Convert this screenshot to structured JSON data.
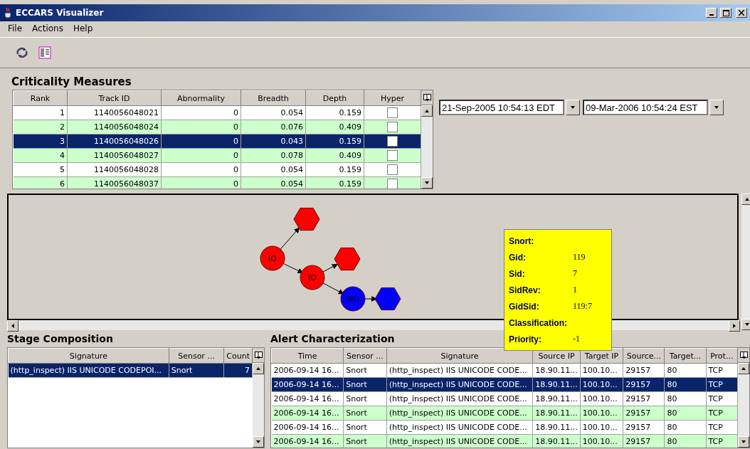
{
  "window": {
    "title": "ECCARS Visualizer"
  },
  "menu": [
    "File",
    "Actions",
    "Help"
  ],
  "criticality": {
    "title": "Criticality Measures",
    "columns": [
      "Rank",
      "Track ID",
      "Abnormality",
      "Breadth",
      "Depth",
      "Hyper"
    ],
    "rows": [
      {
        "cells": [
          "1",
          "1140056048021",
          "0",
          "0.054",
          "0.159"
        ],
        "hyper": false,
        "selected": false
      },
      {
        "cells": [
          "2",
          "1140056048024",
          "0",
          "0.076",
          "0.409"
        ],
        "hyper": false,
        "selected": false
      },
      {
        "cells": [
          "3",
          "1140056048026",
          "0",
          "0.043",
          "0.159"
        ],
        "hyper": false,
        "selected": true
      },
      {
        "cells": [
          "4",
          "1140056048027",
          "0",
          "0.078",
          "0.409"
        ],
        "hyper": false,
        "selected": false
      },
      {
        "cells": [
          "5",
          "1140056048028",
          "0",
          "0.054",
          "0.159"
        ],
        "hyper": false,
        "selected": false
      },
      {
        "cells": [
          "6",
          "1140056048037",
          "0",
          "0.054",
          "0.159"
        ],
        "hyper": false,
        "selected": false
      }
    ]
  },
  "date_range": {
    "start": "21-Sep-2005 10:54:13 EDT",
    "end": "09-Mar-2006 10:54:24 EST"
  },
  "graph": {
    "nodes": [
      {
        "kind": "circle",
        "label": "IO",
        "color": "#ff0000"
      },
      {
        "kind": "hexagon",
        "color": "#ff0000"
      },
      {
        "kind": "circle",
        "label": "IO",
        "color": "#ff0000"
      },
      {
        "kind": "hexagon",
        "color": "#ff0000"
      },
      {
        "kind": "circle",
        "label": "MO",
        "color": "#0000ff"
      },
      {
        "kind": "hexagon",
        "color": "#0000ff"
      }
    ]
  },
  "tooltip": {
    "rows": [
      {
        "label": "Snort:"
      },
      {
        "label": "Gid:",
        "value": "119"
      },
      {
        "label": "Sid:",
        "value": "7"
      },
      {
        "label": "SidRev:",
        "value": "1"
      },
      {
        "label": "GidSid:",
        "value": "119:7"
      },
      {
        "label": "Classification:"
      },
      {
        "label": "Priority:",
        "value": "-1"
      }
    ]
  },
  "stage": {
    "title": "Stage Composition",
    "columns": [
      "Signature",
      "Sensor ...",
      "Count"
    ],
    "rows": [
      {
        "cells": [
          "(http_inspect) IIS UNICODE CODEPOI...",
          "Snort",
          "7"
        ],
        "selected": true
      }
    ]
  },
  "alerts": {
    "title": "Alert Characterization",
    "columns": [
      "Time",
      "Sensor ...",
      "Signature",
      "Source IP",
      "Target IP",
      "Source...",
      "Target...",
      "Prot..."
    ],
    "rows": [
      {
        "cells": [
          "2006-09-14 16...",
          "Snort",
          "(http_inspect) IIS UNICODE CODE...",
          "18.90.11...",
          "100.10...",
          "29157",
          "80",
          "TCP"
        ],
        "selected": false
      },
      {
        "cells": [
          "2006-09-14 16...",
          "Snort",
          "(http_inspect) IIS UNICODE CODE...",
          "18.90.11...",
          "100.10...",
          "29157",
          "80",
          "TCP"
        ],
        "selected": true
      },
      {
        "cells": [
          "2006-09-14 16...",
          "Snort",
          "(http_inspect) IIS UNICODE CODE...",
          "18.90.11...",
          "100.10...",
          "29157",
          "80",
          "TCP"
        ],
        "selected": false
      },
      {
        "cells": [
          "2006-09-14 16...",
          "Snort",
          "(http_inspect) IIS UNICODE CODE...",
          "18.90.11...",
          "100.10...",
          "29157",
          "80",
          "TCP"
        ],
        "selected": false
      },
      {
        "cells": [
          "2006-09-14 16...",
          "Snort",
          "(http_inspect) IIS UNICODE CODE...",
          "18.90.11...",
          "100.10...",
          "29157",
          "80",
          "TCP"
        ],
        "selected": false
      },
      {
        "cells": [
          "2006-09-14 16...",
          "Snort",
          "(http_inspect) IIS UNICODE CODE...",
          "18.90.11...",
          "100.10...",
          "29157",
          "80",
          "TCP"
        ],
        "selected": false
      }
    ]
  }
}
